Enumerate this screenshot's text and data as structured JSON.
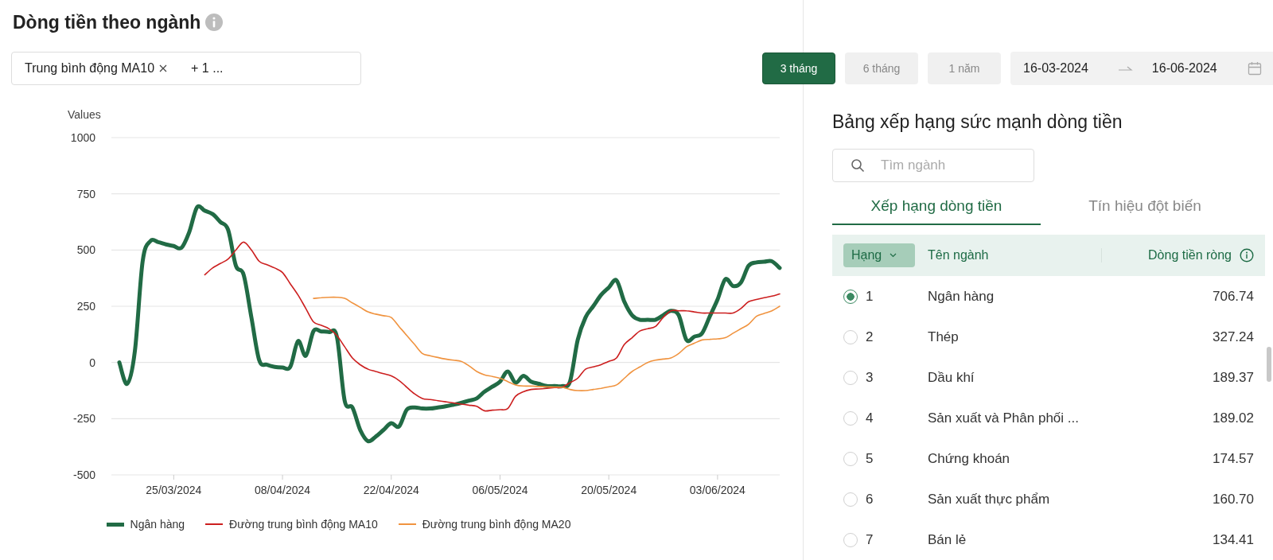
{
  "header": {
    "title": "Dòng tiền theo ngành"
  },
  "filter": {
    "tags": [
      {
        "label": "Trung bình động MA10"
      }
    ],
    "more": "+ 1 ..."
  },
  "periods": [
    {
      "label": "3 tháng",
      "selected": true
    },
    {
      "label": "6 tháng",
      "selected": false
    },
    {
      "label": "1 năm",
      "selected": false
    }
  ],
  "date_range": {
    "start": "16-03-2024",
    "end": "16-06-2024"
  },
  "chart": {
    "chart_data": {
      "type": "line",
      "ylabel": "Values",
      "categories": [
        null,
        null,
        null,
        null,
        null,
        null,
        null,
        "25/03/2024",
        null,
        null,
        null,
        null,
        null,
        null,
        null,
        null,
        null,
        null,
        null,
        null,
        null,
        "08/04/2024",
        null,
        null,
        null,
        null,
        null,
        null,
        null,
        null,
        null,
        null,
        null,
        null,
        null,
        "22/04/2024",
        null,
        null,
        null,
        null,
        null,
        null,
        null,
        null,
        null,
        null,
        null,
        null,
        null,
        "06/05/2024",
        null,
        null,
        null,
        null,
        null,
        null,
        null,
        null,
        null,
        null,
        null,
        null,
        null,
        "20/05/2024",
        null,
        null,
        null,
        null,
        null,
        null,
        null,
        null,
        null,
        null,
        null,
        null,
        null,
        "03/06/2024",
        null,
        null,
        null,
        null,
        null,
        null,
        null,
        null
      ],
      "series": [
        {
          "name": "Ngân hàng",
          "color": "#216b45",
          "values": [
            0,
            -95,
            50,
            450,
            540,
            535,
            525,
            518,
            510,
            580,
            690,
            675,
            660,
            625,
            590,
            430,
            390,
            200,
            10,
            -10,
            -20,
            -22,
            -20,
            95,
            30,
            140,
            138,
            135,
            115,
            -170,
            -200,
            -300,
            -350,
            -330,
            -300,
            -270,
            -285,
            -210,
            -200,
            -205,
            -205,
            -200,
            -195,
            -188,
            -180,
            -170,
            -160,
            -130,
            -108,
            -85,
            -40,
            -90,
            -60,
            -85,
            -95,
            -105,
            -105,
            -105,
            -85,
            100,
            200,
            250,
            300,
            333,
            365,
            270,
            210,
            190,
            190,
            190,
            210,
            230,
            210,
            100,
            115,
            130,
            205,
            280,
            370,
            340,
            355,
            430,
            445,
            448,
            450,
            420
          ]
        },
        {
          "name": "Đường trung bình động MA10",
          "color": "#cc1f1f",
          "values": [
            null,
            null,
            null,
            null,
            null,
            null,
            null,
            null,
            null,
            null,
            null,
            390,
            420,
            440,
            460,
            500,
            535,
            500,
            450,
            435,
            420,
            400,
            350,
            300,
            240,
            180,
            165,
            150,
            120,
            70,
            20,
            -10,
            -30,
            -40,
            -50,
            -60,
            -80,
            -110,
            -140,
            -160,
            -165,
            -170,
            -175,
            -180,
            -185,
            -190,
            -195,
            -215,
            -212,
            -210,
            -205,
            -150,
            -130,
            -120,
            -118,
            -115,
            -112,
            -110,
            -90,
            -70,
            -30,
            -20,
            -10,
            5,
            20,
            80,
            110,
            140,
            150,
            160,
            200,
            230,
            230,
            230,
            225,
            220,
            220,
            220,
            220,
            220,
            240,
            270,
            280,
            288,
            295,
            305
          ]
        },
        {
          "name": "Đường trung bình động MA20",
          "color": "#f0933f",
          "values": [
            null,
            null,
            null,
            null,
            null,
            null,
            null,
            null,
            null,
            null,
            null,
            null,
            null,
            null,
            null,
            null,
            null,
            null,
            null,
            null,
            null,
            null,
            null,
            null,
            null,
            285,
            288,
            290,
            290,
            285,
            265,
            245,
            225,
            215,
            208,
            200,
            160,
            120,
            80,
            40,
            30,
            22,
            15,
            10,
            5,
            -15,
            -40,
            -55,
            -62,
            -70,
            -85,
            -100,
            -105,
            -105,
            -107,
            -108,
            -109,
            -110,
            -120,
            -125,
            -125,
            -120,
            -115,
            -108,
            -100,
            -70,
            -40,
            -20,
            0,
            10,
            15,
            20,
            40,
            70,
            85,
            100,
            103,
            105,
            110,
            130,
            150,
            170,
            205,
            218,
            230,
            250
          ]
        }
      ],
      "grid": true,
      "legend": "bottom",
      "ylim": [
        -500,
        1000
      ],
      "yticks": [
        -500,
        -250,
        0,
        250,
        500,
        750,
        1000
      ]
    }
  },
  "ranking": {
    "title": "Bảng xếp hạng sức mạnh dòng tiền",
    "search": {
      "placeholder": "Tìm ngành"
    },
    "tabs": [
      {
        "label": "Xếp hạng dòng tiền",
        "selected": true
      },
      {
        "label": "Tín hiệu đột biến",
        "selected": false
      }
    ],
    "sort_button": "Hạng",
    "columns": [
      "Tên ngành",
      "Dòng tiền ròng"
    ],
    "rows": [
      {
        "rank": "1",
        "name": "Ngân hàng",
        "value": "706.74",
        "selected": true
      },
      {
        "rank": "2",
        "name": "Thép",
        "value": "327.24",
        "selected": false
      },
      {
        "rank": "3",
        "name": "Dầu khí",
        "value": "189.37",
        "selected": false
      },
      {
        "rank": "4",
        "name": "Sản xuất và Phân phối ...",
        "value": "189.02",
        "selected": false
      },
      {
        "rank": "5",
        "name": "Chứng khoán",
        "value": "174.57",
        "selected": false
      },
      {
        "rank": "6",
        "name": "Sản xuất thực phẩm",
        "value": "160.70",
        "selected": false
      },
      {
        "rank": "7",
        "name": "Bán lẻ",
        "value": "134.41",
        "selected": false
      }
    ]
  }
}
